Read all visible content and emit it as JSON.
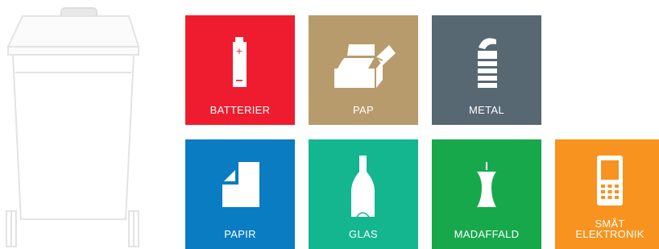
{
  "tiles": [
    {
      "key": "batterier",
      "label": "BATTERIER",
      "color": "#ee1c2e",
      "icon": "battery-icon"
    },
    {
      "key": "pap",
      "label": "PAP",
      "color": "#b89b6c",
      "icon": "cardboard-box-icon"
    },
    {
      "key": "metal",
      "label": "METAL",
      "color": "#586873",
      "icon": "tin-can-icon"
    },
    {
      "key": "papir",
      "label": "PAPIR",
      "color": "#0a7cc2",
      "icon": "paper-sheet-icon"
    },
    {
      "key": "glas",
      "label": "GLAS",
      "color": "#14b690",
      "icon": "bottle-icon"
    },
    {
      "key": "madaffald",
      "label": "MADAFFALD",
      "color": "#17a84c",
      "icon": "apple-core-icon"
    },
    {
      "key": "elektronik",
      "label_line1": "SMÅT",
      "label_line2": "ELEKTRONIK",
      "color": "#f7931e",
      "icon": "mobile-phone-icon"
    }
  ],
  "bin": {
    "icon": "waste-bin-icon",
    "color": "#e6e6e6"
  }
}
